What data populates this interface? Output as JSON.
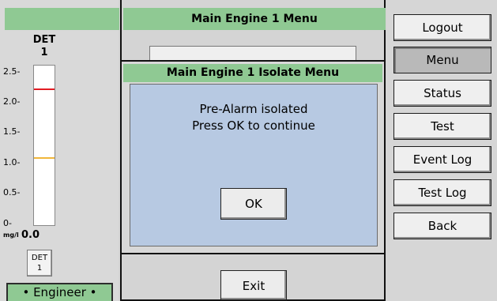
{
  "detector": {
    "title": "DET",
    "number": "1",
    "ticks": [
      "2.5-",
      "2.0-",
      "1.5-",
      "1.0-",
      "0.5-",
      "0-"
    ],
    "unit": "mg/l",
    "reading": "0.0",
    "alarm_color": "#e31c23",
    "prealarm_color": "#f1b63a",
    "button_line1": "DET",
    "button_line2": "1"
  },
  "engineer_label": "• Engineer •",
  "main_menu": {
    "title": "Main Engine 1 Menu",
    "exit_label": "Exit"
  },
  "isolate_dialog": {
    "title": "Main Engine 1 Isolate Menu",
    "message_line1": "Pre-Alarm isolated",
    "message_line2": "Press OK to continue",
    "ok_label": "OK"
  },
  "nav": {
    "items": [
      {
        "label": "Logout"
      },
      {
        "label": "Menu"
      },
      {
        "label": "Status"
      },
      {
        "label": "Test"
      },
      {
        "label": "Event Log"
      },
      {
        "label": "Test Log"
      },
      {
        "label": "Back"
      }
    ],
    "active_index": 1
  },
  "colors": {
    "header_green": "#8fc993",
    "dialog_blue": "#b7c9e2",
    "panel_gray": "#d4d4d4"
  }
}
